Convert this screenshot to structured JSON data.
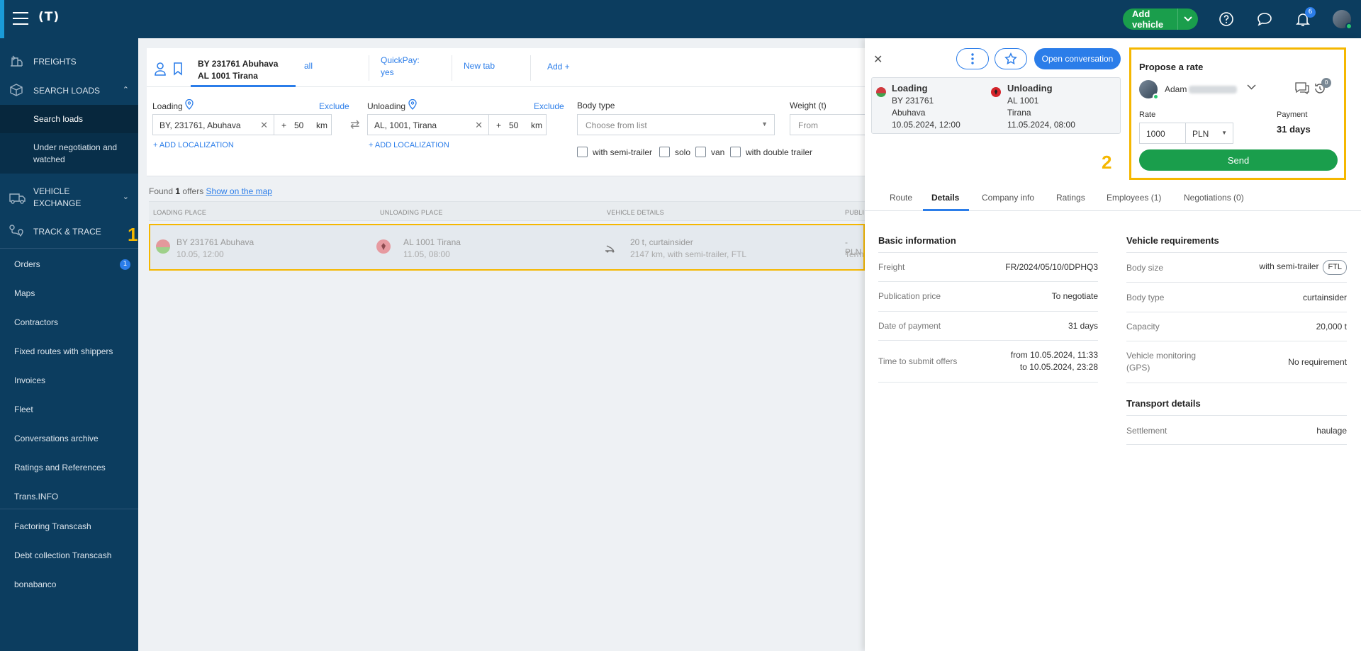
{
  "topbar": {
    "logo": "(T)",
    "add_vehicle_label": "Add vehicle",
    "notifications_count": "6"
  },
  "sidebar": {
    "freights": "FREIGHTS",
    "search_loads": "SEARCH LOADS",
    "search_loads_sub": [
      "Search loads",
      "Under negotiation and watched"
    ],
    "vehicle_exchange": "VEHICLE EXCHANGE",
    "track_trace": "TRACK & TRACE",
    "orders": "Orders",
    "orders_badge": "1",
    "items": [
      "Maps",
      "Contractors",
      "Fixed routes with shippers",
      "Invoices",
      "Fleet",
      "Conversations archive",
      "Ratings and References",
      "Trans.INFO"
    ],
    "items2": [
      "Factoring Transcash",
      "Debt collection Transcash",
      "bonabanco"
    ]
  },
  "tabs": {
    "active_line1": "BY 231761 Abuhava",
    "active_line2": "AL 1001 Tirana",
    "all": "all",
    "quickpay_line1": "QuickPay:",
    "quickpay_line2": "yes",
    "new_tab": "New tab",
    "add": "Add +"
  },
  "filters": {
    "loading_label": "Loading",
    "unloading_label": "Unloading",
    "exclude": "Exclude",
    "loading_value": "BY, 231761, Abuhava",
    "unloading_value": "AL, 1001, Tirana",
    "plus": "+",
    "radius": "50",
    "km": "km",
    "add_localization": "+ ADD LOCALIZATION",
    "body_type_label": "Body type",
    "body_type_placeholder": "Choose from list",
    "weight_label": "Weight (t)",
    "weight_placeholder": "From",
    "checkboxes": [
      "with semi-trailer",
      "solo",
      "van",
      "with double trailer"
    ]
  },
  "results": {
    "found_prefix": "Found",
    "found_count": "1",
    "found_suffix": "offers",
    "show_map": "Show on the map",
    "columns": [
      "LOADING PLACE",
      "UNLOADING PLACE",
      "VEHICLE DETAILS",
      "PUBLI"
    ],
    "row": {
      "loading_place": "BY 231761 Abuhava",
      "loading_time": "10.05, 12:00",
      "unloading_place": "AL 1001 Tirana",
      "unloading_time": "11.05, 08:00",
      "vehicle_line1": "20 t, curtainsider",
      "vehicle_line2": "2147 km, with semi-trailer, FTL",
      "price_line1": "- PLN",
      "price_line2": "Term"
    },
    "marker_1": "1"
  },
  "panel": {
    "open_conversation": "Open conversation",
    "loading": {
      "title": "Loading",
      "code": "BY 231761",
      "city": "Abuhava",
      "date": "10.05.2024, 12:00"
    },
    "unloading": {
      "title": "Unloading",
      "code": "AL 1001",
      "city": "Tirana",
      "date": "11.05.2024, 08:00"
    },
    "marker_2": "2",
    "propose": {
      "title": "Propose a rate",
      "name": "Adam",
      "history_badge": "0",
      "rate_label": "Rate",
      "rate_value": "1000",
      "currency": "PLN",
      "payment_label": "Payment",
      "payment_value": "31 days",
      "send": "Send"
    },
    "tabs": [
      "Route",
      "Details",
      "Company info",
      "Ratings",
      "Employees (1)",
      "Negotiations (0)"
    ],
    "basic": {
      "title": "Basic information",
      "rows": [
        {
          "k": "Freight",
          "v": "FR/2024/05/10/0DPHQ3"
        },
        {
          "k": "Publication price",
          "v": "To negotiate"
        },
        {
          "k": "Date of payment",
          "v": "31 days"
        },
        {
          "k": "Time to submit offers",
          "v1": "from 10.05.2024, 11:33",
          "v2": "to 10.05.2024, 23:28"
        }
      ]
    },
    "vehicle": {
      "title": "Vehicle requirements",
      "rows": [
        {
          "k": "Body size",
          "v": "with semi-trailer",
          "tag": "FTL"
        },
        {
          "k": "Body type",
          "v": "curtainsider"
        },
        {
          "k": "Capacity",
          "v": "20,000 t"
        },
        {
          "k1": "Vehicle monitoring",
          "k2": "(GPS)",
          "v": "No requirement"
        }
      ]
    },
    "transport": {
      "title": "Transport details",
      "rows": [
        {
          "k": "Settlement",
          "v": "haulage"
        }
      ]
    }
  }
}
